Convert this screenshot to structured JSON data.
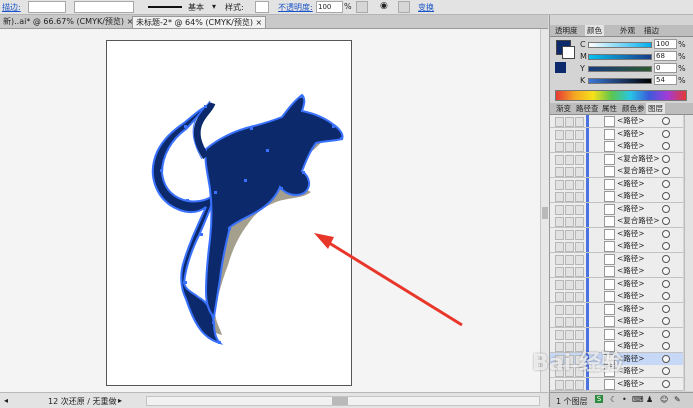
{
  "control_bar": {
    "stroke_label": "描边:",
    "brush_label": "基本",
    "style_label": "样式:",
    "opacity_label": "不透明度:",
    "opacity_value": "100",
    "percent": "%",
    "replace_label": "变换"
  },
  "doc_tabs": [
    {
      "label": "新)..ai* @ 66.67% (CMYK/预览)",
      "close": "×"
    },
    {
      "label": "未标题-2* @ 64% (CMYK/预览)",
      "close": "×"
    }
  ],
  "color_panel": {
    "tabs": [
      "透明度",
      "颜色",
      "外观",
      "描边"
    ],
    "channels": [
      {
        "name": "C",
        "value": "100"
      },
      {
        "name": "M",
        "value": "68"
      },
      {
        "name": "Y",
        "value": "0"
      },
      {
        "name": "K",
        "value": "54"
      }
    ],
    "percent": "%",
    "fill_color": "#0c2a6b"
  },
  "layers_panel": {
    "tabs": [
      "渐变",
      "路径查",
      "属性",
      "颜色参",
      "图层"
    ],
    "rows": [
      "<路径>",
      "<路径>",
      "<路径>",
      "<复合路径>",
      "<复合路径>",
      "<路径>",
      "<路径>",
      "<路径>",
      "<复合路径>",
      "<路径>",
      "<路径>",
      "<路径>",
      "<路径>",
      "<路径>",
      "<路径>",
      "<路径>",
      "<路径>",
      "<路径>",
      "<路径>",
      "<路径>",
      "<路径>",
      "<路径>"
    ],
    "footer": "1 个图层"
  },
  "status_bar": {
    "undo_text": "12 次还原 / 无重做"
  },
  "watermark": "Bai 经验",
  "colors": {
    "kangaroo_fill": "#0c2a6b",
    "shadow": "#a59f8e",
    "selection": "#3a72ff",
    "arrow": "#e9362a"
  }
}
